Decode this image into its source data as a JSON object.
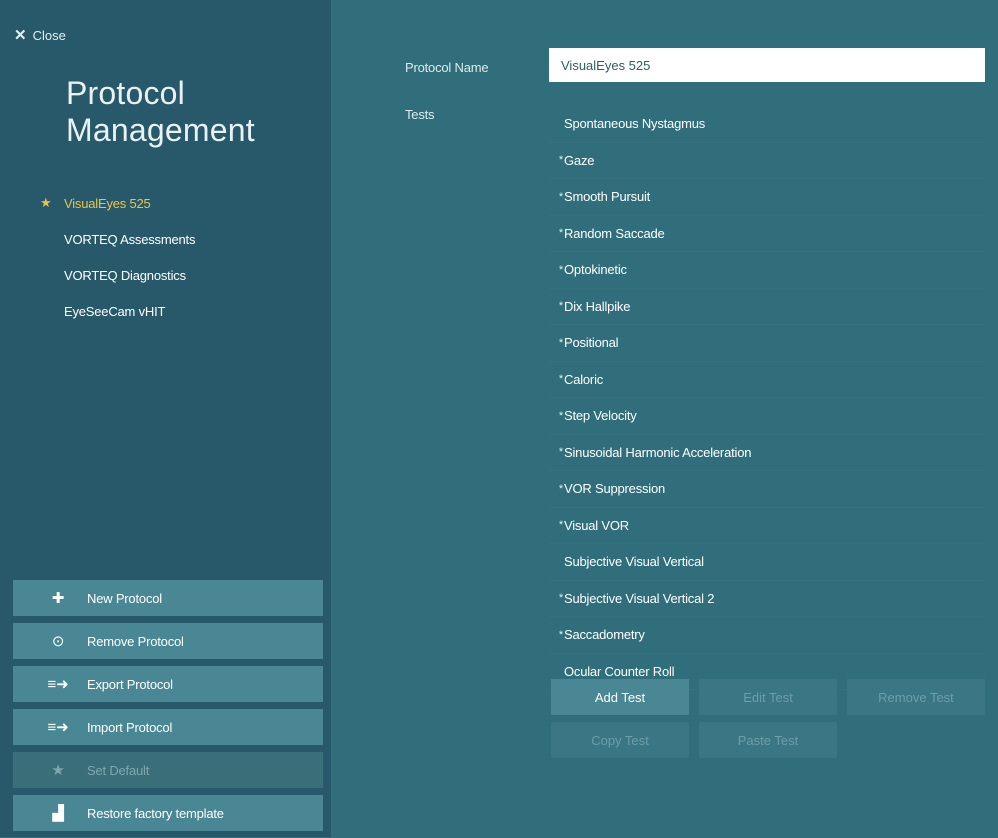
{
  "sidebar": {
    "close_label": "Close",
    "title_line1": "Protocol",
    "title_line2": "Management",
    "protocols": [
      {
        "label": "VisualEyes 525",
        "active": true
      },
      {
        "label": "VORTEQ Assessments",
        "active": false
      },
      {
        "label": "VORTEQ Diagnostics",
        "active": false
      },
      {
        "label": "EyeSeeCam vHIT",
        "active": false
      }
    ],
    "actions": {
      "new": "New Protocol",
      "remove": "Remove Protocol",
      "export": "Export Protocol",
      "import": "Import Protocol",
      "set_default": "Set Default",
      "restore": "Restore factory template"
    }
  },
  "main": {
    "protocol_name_label": "Protocol Name",
    "protocol_name_value": "VisualEyes 525",
    "tests_label": "Tests",
    "tests": [
      {
        "mark": "",
        "label": "Spontaneous Nystagmus"
      },
      {
        "mark": "*",
        "label": "Gaze"
      },
      {
        "mark": "*",
        "label": "Smooth Pursuit"
      },
      {
        "mark": "*",
        "label": "Random Saccade"
      },
      {
        "mark": "*",
        "label": "Optokinetic"
      },
      {
        "mark": "*",
        "label": "Dix Hallpike"
      },
      {
        "mark": "*",
        "label": "Positional"
      },
      {
        "mark": "*",
        "label": "Caloric"
      },
      {
        "mark": "*",
        "label": "Step Velocity"
      },
      {
        "mark": "*",
        "label": "Sinusoidal Harmonic Acceleration"
      },
      {
        "mark": "*",
        "label": "VOR Suppression"
      },
      {
        "mark": "*",
        "label": "Visual VOR"
      },
      {
        "mark": "",
        "label": "Subjective Visual Vertical"
      },
      {
        "mark": "*",
        "label": "Subjective Visual Vertical 2"
      },
      {
        "mark": "*",
        "label": "Saccadometry"
      },
      {
        "mark": "",
        "label": "Ocular Counter Roll"
      }
    ],
    "buttons": {
      "add": "Add Test",
      "edit": "Edit Test",
      "remove": "Remove Test",
      "copy": "Copy Test",
      "paste": "Paste Test"
    }
  },
  "colors": {
    "background": "#2f6e7a",
    "sidebar": "#27596a",
    "accent_star": "#e8c54a",
    "button": "#4a8794"
  }
}
